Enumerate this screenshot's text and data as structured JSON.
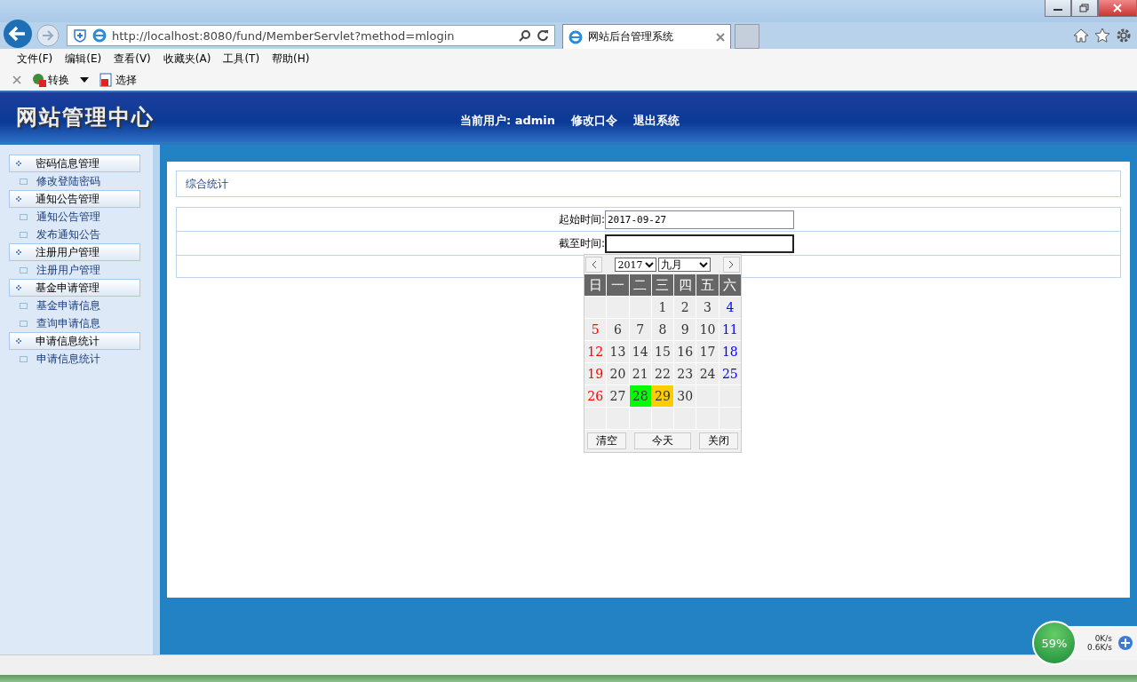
{
  "browser": {
    "address": "http://localhost:8080/fund/MemberServlet?method=mlogin",
    "tab_title": "网站后台管理系统",
    "menu": [
      "文件(F)",
      "编辑(E)",
      "查看(V)",
      "收藏夹(A)",
      "工具(T)",
      "帮助(H)"
    ],
    "toolbar": [
      "转换",
      "选择"
    ]
  },
  "header": {
    "logo": "网站管理中心",
    "user_label": "当前用户:",
    "user": "admin",
    "links": [
      "修改口令",
      "退出系统"
    ]
  },
  "sidebar": [
    {
      "title": "密码信息管理",
      "items": [
        "修改登陆密码"
      ]
    },
    {
      "title": "通知公告管理",
      "items": [
        "通知公告管理",
        "发布通知公告"
      ]
    },
    {
      "title": "注册用户管理",
      "items": [
        "注册用户管理"
      ]
    },
    {
      "title": "基金申请管理",
      "items": [
        "基金申请信息",
        "查询申请信息"
      ]
    },
    {
      "title": "申请信息统计",
      "items": [
        "申请信息统计"
      ]
    }
  ],
  "panel": {
    "title": "综合统计",
    "fields": [
      {
        "label": "起始时间:",
        "value": "2017-09-27"
      },
      {
        "label": "截至时间:"
      }
    ]
  },
  "calendar": {
    "year": "2017",
    "month": "九月",
    "weekdays": [
      "日",
      "一",
      "二",
      "三",
      "四",
      "五",
      "六"
    ],
    "weeks": [
      [
        {
          "blank": true
        },
        {
          "blank": true
        },
        {
          "blank": true
        },
        {
          "d": "1",
          "today": false,
          "selected": false
        },
        {
          "d": "2",
          "today": false,
          "selected": false
        },
        {
          "d": "3",
          "today": false,
          "selected": false
        },
        {
          "d": "4",
          "today": false,
          "selected": false
        }
      ],
      [
        {
          "d": "5",
          "today": false,
          "selected": false
        },
        {
          "d": "6",
          "today": false,
          "selected": false
        },
        {
          "d": "7",
          "today": false,
          "selected": false
        },
        {
          "d": "8",
          "today": false,
          "selected": false
        },
        {
          "d": "9",
          "today": false,
          "selected": false
        },
        {
          "d": "10",
          "today": false,
          "selected": false
        },
        {
          "d": "11",
          "today": false,
          "selected": false
        }
      ],
      [
        {
          "d": "12",
          "today": false,
          "selected": false
        },
        {
          "d": "13",
          "today": false,
          "selected": false
        },
        {
          "d": "14",
          "today": false,
          "selected": false
        },
        {
          "d": "15",
          "today": false,
          "selected": false
        },
        {
          "d": "16",
          "today": false,
          "selected": false
        },
        {
          "d": "17",
          "today": false,
          "selected": false
        },
        {
          "d": "18",
          "today": false,
          "selected": false
        }
      ],
      [
        {
          "d": "19",
          "today": false,
          "selected": false
        },
        {
          "d": "20",
          "today": false,
          "selected": false
        },
        {
          "d": "21",
          "today": false,
          "selected": false
        },
        {
          "d": "22",
          "today": false,
          "selected": false
        },
        {
          "d": "23",
          "today": false,
          "selected": false
        },
        {
          "d": "24",
          "today": false,
          "selected": false
        },
        {
          "d": "25",
          "today": false,
          "selected": false
        }
      ],
      [
        {
          "d": "26",
          "today": false,
          "selected": false
        },
        {
          "d": "27",
          "today": false,
          "selected": false
        },
        {
          "d": "28",
          "today": true,
          "selected": false
        },
        {
          "d": "29",
          "today": false,
          "selected": true
        },
        {
          "d": "30",
          "today": false,
          "selected": false
        },
        {
          "blank": true
        },
        {
          "blank": true
        }
      ],
      [
        {
          "blank": true
        },
        {
          "blank": true
        },
        {
          "blank": true
        },
        {
          "blank": true
        },
        {
          "blank": true
        },
        {
          "blank": true
        },
        {
          "blank": true
        }
      ]
    ],
    "buttons": [
      "清空",
      "今天",
      "关闭"
    ]
  },
  "net_widget": {
    "percent": "59%",
    "up": "0K/s",
    "down": "0.6K/s"
  }
}
